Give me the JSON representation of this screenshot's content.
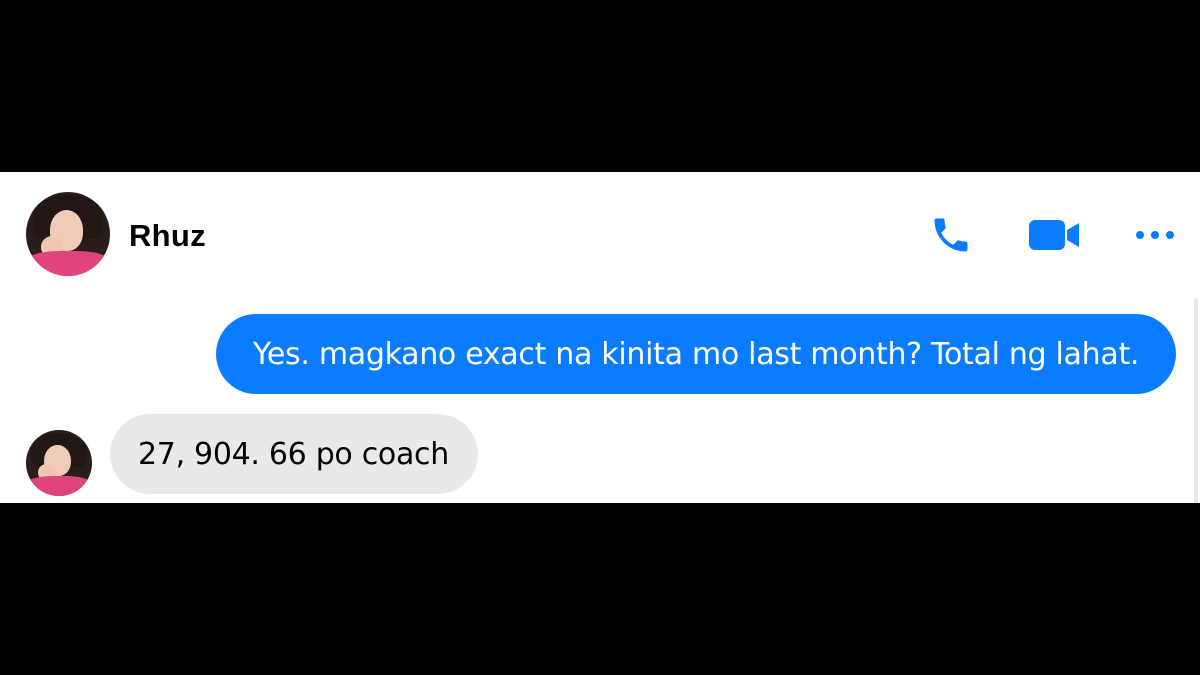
{
  "contact": {
    "name": "Rhuz"
  },
  "header": {
    "actions": [
      {
        "icon": "phone-icon"
      },
      {
        "icon": "video-camera-icon"
      },
      {
        "icon": "more-options-icon"
      }
    ]
  },
  "messages": [
    {
      "direction": "outgoing",
      "text": "Yes. magkano exact na kinita mo last month? Total ng lahat."
    },
    {
      "direction": "incoming",
      "text": "27, 904. 66 po coach"
    }
  ],
  "colors": {
    "accent": "#0a7cff",
    "outgoing_bubble": "#0a7cff",
    "incoming_bubble": "#e9e9eb",
    "letterbox": "#000000",
    "panel": "#ffffff"
  }
}
